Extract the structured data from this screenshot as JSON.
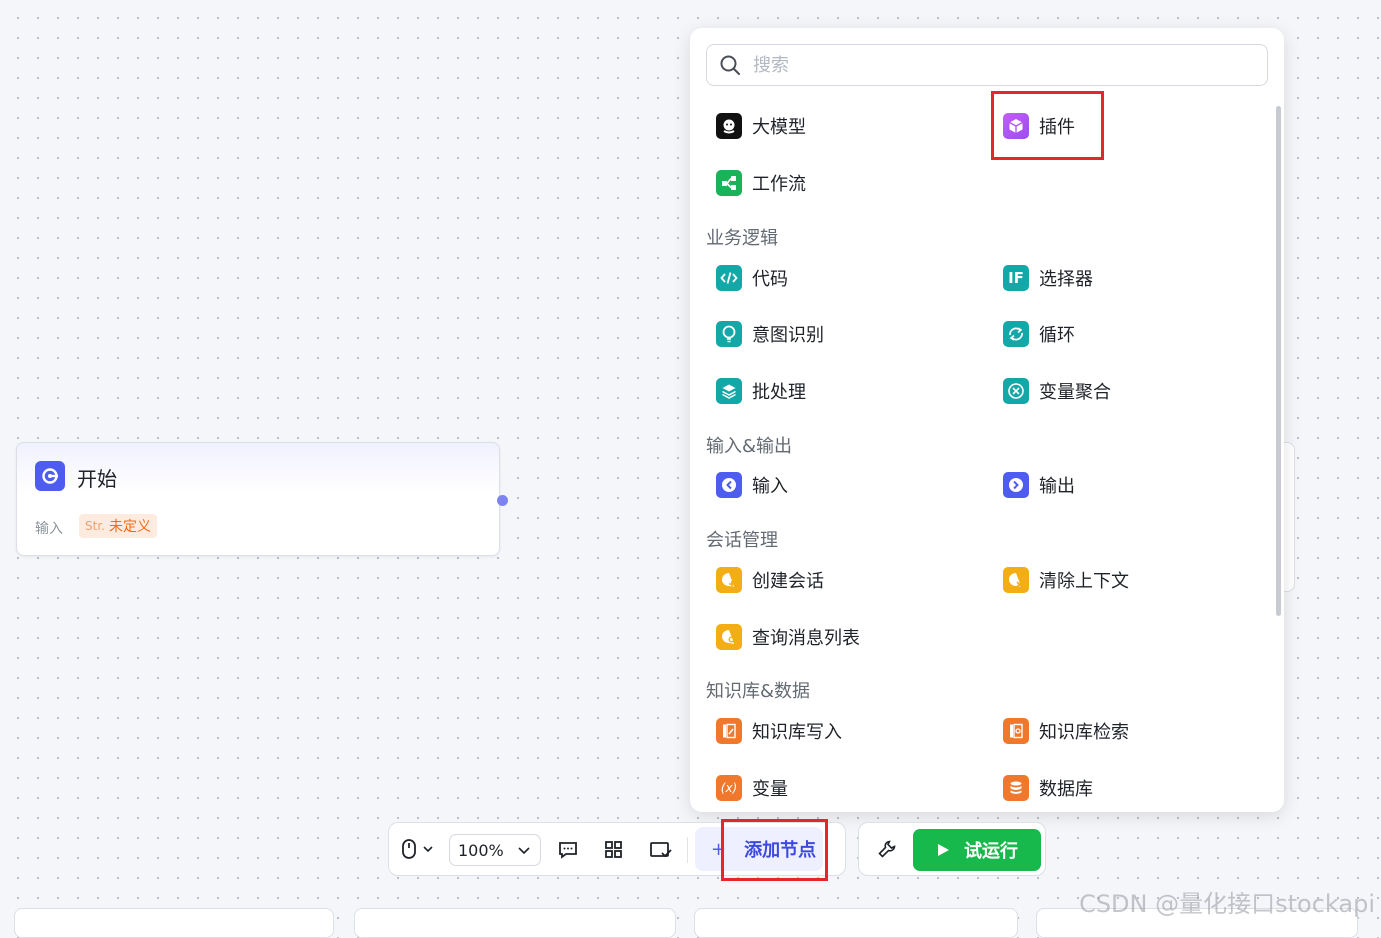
{
  "start_node": {
    "title": "开始",
    "input_label": "输入",
    "tag_type": "Str.",
    "tag_value": "未定义"
  },
  "panel": {
    "search_placeholder": "搜索",
    "top_items": [
      "大模型",
      "插件",
      "工作流"
    ],
    "sections": [
      {
        "title": "业务逻辑",
        "items": [
          "代码",
          "选择器",
          "意图识别",
          "循环",
          "批处理",
          "变量聚合"
        ]
      },
      {
        "title": "输入&输出",
        "items": [
          "输入",
          "输出"
        ]
      },
      {
        "title": "会话管理",
        "items": [
          "创建会话",
          "清除上下文",
          "查询消息列表"
        ]
      },
      {
        "title": "知识库&数据",
        "items": [
          "知识库写入",
          "知识库检索",
          "变量",
          "数据库"
        ]
      }
    ]
  },
  "toolbar": {
    "zoom": "100%",
    "add_node_label": "添加节点",
    "run_label": "试运行"
  },
  "watermark": "CSDN @量化接口stockapi",
  "colors": {
    "accent": "#4e5cf0",
    "run_green": "#18b94c",
    "highlight_red": "#e5272c"
  }
}
